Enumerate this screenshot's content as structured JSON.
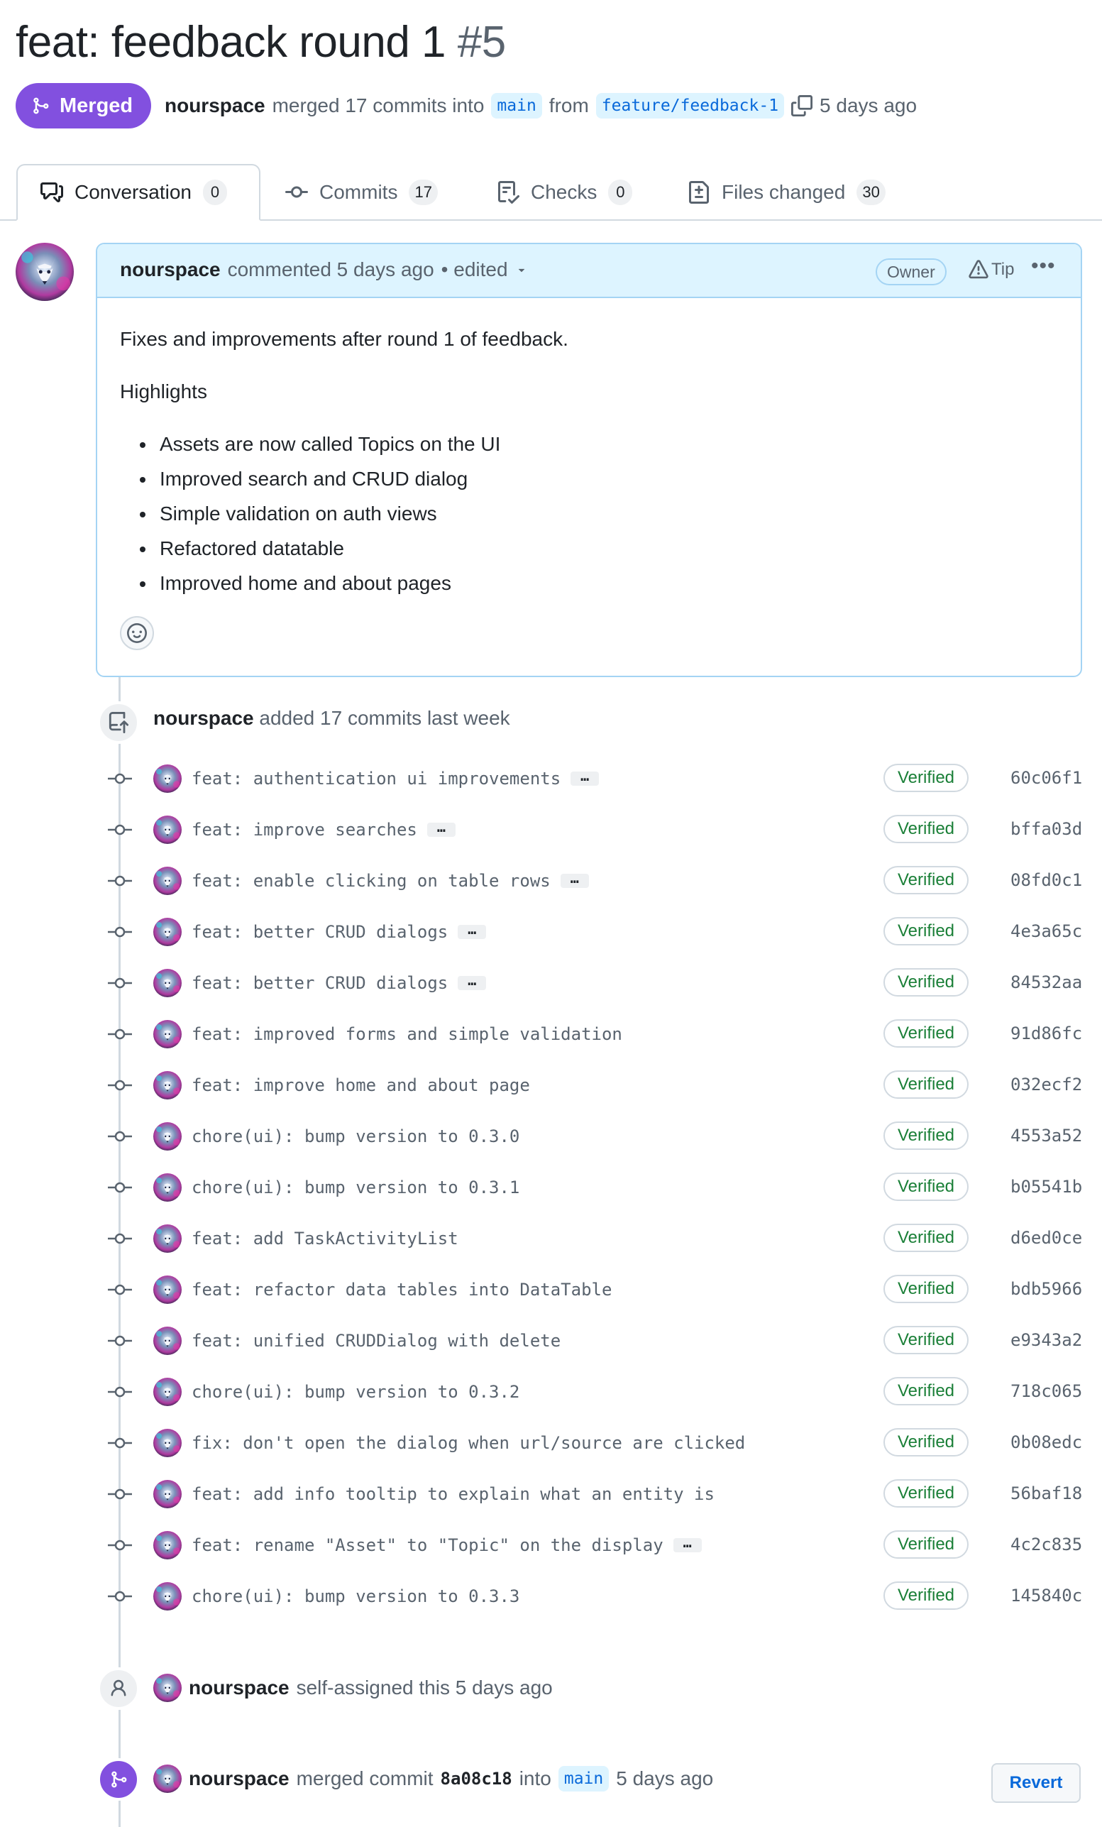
{
  "pr": {
    "title": "feat: feedback round 1",
    "number": "#5",
    "status": "Merged",
    "author": "nourspace",
    "merge_text": "merged 17 commits into",
    "base_branch": "main",
    "from_text": "from",
    "head_branch": "feature/feedback-1",
    "time_ago": "5 days ago"
  },
  "tabs": [
    {
      "label": "Conversation",
      "count": "0",
      "icon": "comment-discussion-icon"
    },
    {
      "label": "Commits",
      "count": "17",
      "icon": "git-commit-icon"
    },
    {
      "label": "Checks",
      "count": "0",
      "icon": "checklist-icon"
    },
    {
      "label": "Files changed",
      "count": "30",
      "icon": "file-diff-icon"
    }
  ],
  "comment": {
    "author": "nourspace",
    "action": "commented 5 days ago",
    "edited": "• edited",
    "role_badge": "Owner",
    "tip_label": "Tip",
    "intro": "Fixes and improvements after round 1 of feedback.",
    "heading": "Highlights",
    "bullets": [
      "Assets are now called Topics on the UI",
      "Improved search and CRUD dialog",
      "Simple validation on auth views",
      "Refactored datatable",
      "Improved home and about pages"
    ]
  },
  "commits_event": {
    "author": "nourspace",
    "text": "added 17 commits last week"
  },
  "verified_label": "Verified",
  "commits": [
    {
      "message": "feat: authentication ui improvements",
      "sha": "60c06f1",
      "has_more": true
    },
    {
      "message": "feat: improve searches",
      "sha": "bffa03d",
      "has_more": true
    },
    {
      "message": "feat: enable clicking on table rows",
      "sha": "08fd0c1",
      "has_more": true
    },
    {
      "message": "feat: better CRUD dialogs",
      "sha": "4e3a65c",
      "has_more": true
    },
    {
      "message": "feat: better CRUD dialogs",
      "sha": "84532aa",
      "has_more": true
    },
    {
      "message": "feat: improved forms and simple validation",
      "sha": "91d86fc",
      "has_more": false
    },
    {
      "message": "feat: improve home and about page",
      "sha": "032ecf2",
      "has_more": false
    },
    {
      "message": "chore(ui): bump version to 0.3.0",
      "sha": "4553a52",
      "has_more": false
    },
    {
      "message": "chore(ui): bump version to 0.3.1",
      "sha": "b05541b",
      "has_more": false
    },
    {
      "message": "feat: add TaskActivityList",
      "sha": "d6ed0ce",
      "has_more": false
    },
    {
      "message": "feat: refactor data tables into DataTable",
      "sha": "bdb5966",
      "has_more": false
    },
    {
      "message": "feat: unified CRUDDialog with delete",
      "sha": "e9343a2",
      "has_more": false
    },
    {
      "message": "chore(ui): bump version to 0.3.2",
      "sha": "718c065",
      "has_more": false
    },
    {
      "message": "fix: don't open the dialog when url/source are clicked",
      "sha": "0b08edc",
      "has_more": false
    },
    {
      "message": "feat: add info tooltip to explain what an entity is",
      "sha": "56baf18",
      "has_more": false
    },
    {
      "message": "feat: rename \"Asset\" to \"Topic\" on the display",
      "sha": "4c2c835",
      "has_more": true
    },
    {
      "message": "chore(ui): bump version to 0.3.3",
      "sha": "145840c",
      "has_more": false
    }
  ],
  "assign_event": {
    "author": "nourspace",
    "text": "self-assigned this 5 days ago"
  },
  "merge_event": {
    "author": "nourspace",
    "text": "merged commit",
    "sha": "8a08c18",
    "into_text": "into",
    "branch": "main",
    "time_ago": "5 days ago",
    "revert_label": "Revert"
  },
  "colors": {
    "merged_purple": "#8250df",
    "verified_green": "#1a7f37",
    "link_blue": "#0969da",
    "comment_header_bg": "#ddf4ff"
  }
}
